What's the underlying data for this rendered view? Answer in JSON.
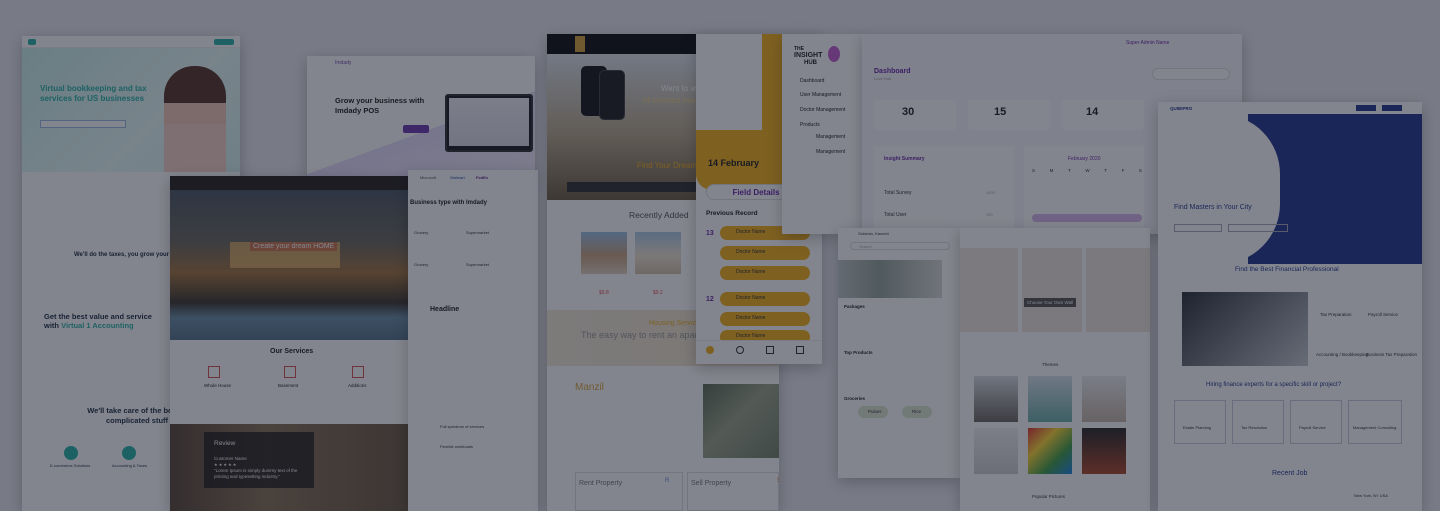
{
  "card_bookkeeping": {
    "hero_title": "Virtual bookkeeping and tax services for US businesses",
    "section1": "We'll do the taxes, you grow your business",
    "section2_title_a": "Get the best value and service with ",
    "section2_title_b": "Virtual 1 Accounting",
    "section3": "We'll take care of the boring complicated stuff",
    "service1": "E-commerce Solutions",
    "service2": "Accounting & Taxes"
  },
  "card_imdady": {
    "logo": "Imdady",
    "headline": "Grow your business with Imdady POS",
    "cta": "Get Started"
  },
  "card_realestate": {
    "hero_text": "Create your dream HOME",
    "services_title": "Our Services",
    "service_titles": [
      "Whole House",
      "Basement",
      "Additions"
    ],
    "review_title": "Review",
    "review_name": "Customer Name",
    "review_stars": "★ ★ ★ ★ ★",
    "review_quote": "\"Lorem Ipsum is simply dummy text of the printing and typesetting industry.\""
  },
  "card_imdady_types": {
    "brands": [
      "Microsoft",
      "Walmart",
      "FedEx"
    ],
    "title": "Business type with Imdady",
    "types": [
      "Grocery",
      "Supermarket",
      "Grocery",
      "Supermarket"
    ],
    "headline": "Headline",
    "feature1": "Full spectrum of services",
    "feature2": "Flexible workloads"
  },
  "card_property": {
    "banner_line1": "Want to avail the service",
    "banner_line2": "of contract management sy",
    "banner_btn": "Learn More",
    "find_dream": "Find Your Dream",
    "recently_added": "Recently Added",
    "prices": [
      "$9.8",
      "$9.2"
    ],
    "housing_title": "Housing Service",
    "housing_sub": "The easy way to rent an apar",
    "manzil": "Manzil",
    "rent": "Rent Property",
    "sell": "Sell Property",
    "rent_badge": "R",
    "sell_badge": "S"
  },
  "card_field": {
    "date": "14 February",
    "button": "Field Details",
    "previous": "Previous Record",
    "day_numbers": [
      "13",
      "12"
    ],
    "doctor_items": [
      "Doctor Name",
      "Doctor Name",
      "Doctor Name",
      "Doctor Name",
      "Doctor Name",
      "Doctor Name"
    ]
  },
  "card_insight_nav": {
    "logo_line1": "THE",
    "logo_line2": "INSIGHT",
    "logo_line3": "HUB",
    "items": [
      "Dashboard",
      "User Management",
      "Doctor Management",
      "Products",
      "Management",
      "Management"
    ]
  },
  "card_dashboard": {
    "user": "Super Admin Name",
    "title": "Dashboard",
    "breadcrumb": "Love Hub",
    "stats": [
      "30",
      "15",
      "14"
    ],
    "summary_title": "Insight Summary",
    "summary_rows": [
      "Total Survey",
      "Total User"
    ],
    "summary_values": [
      "1000",
      "250"
    ],
    "calendar_title": "February 2020",
    "weekdays": [
      "S",
      "M",
      "T",
      "W",
      "T",
      "F",
      "S"
    ]
  },
  "card_grocery": {
    "location": "Gulshan, Karachi",
    "search_placeholder": "Search",
    "packages": "Packages",
    "top_products": "Top Products",
    "groceries": "Groceries",
    "chips": [
      "Pulses",
      "Rice"
    ]
  },
  "card_art": {
    "overlay_btn": "Choose Your Own Wall",
    "themes": "Themes",
    "popular": "Popular Pictures"
  },
  "card_finance": {
    "logo": "QUIBIPRO",
    "hero": "Find Masters in Your City",
    "section_title": "Find the Best Financial Professional",
    "services": [
      "Tax Preparation",
      "Payroll Service",
      "Accounting / Bookkeeping",
      "Business Tax Preparation"
    ],
    "hiring_title": "Hiring finance experts for a specific skill or project?",
    "tiles": [
      "Estate Planning",
      "Tax Resolution",
      "Payroll Service",
      "Management Consulting"
    ],
    "recent_job": "Recent Job",
    "job_location": "New York, NY USA"
  },
  "colors": {
    "teal": "#2bb5a8",
    "orange": "#f4b21a",
    "purple": "#8a3fb3",
    "navy": "#253a8c",
    "dim": "rgba(18,22,38,0.52)"
  }
}
